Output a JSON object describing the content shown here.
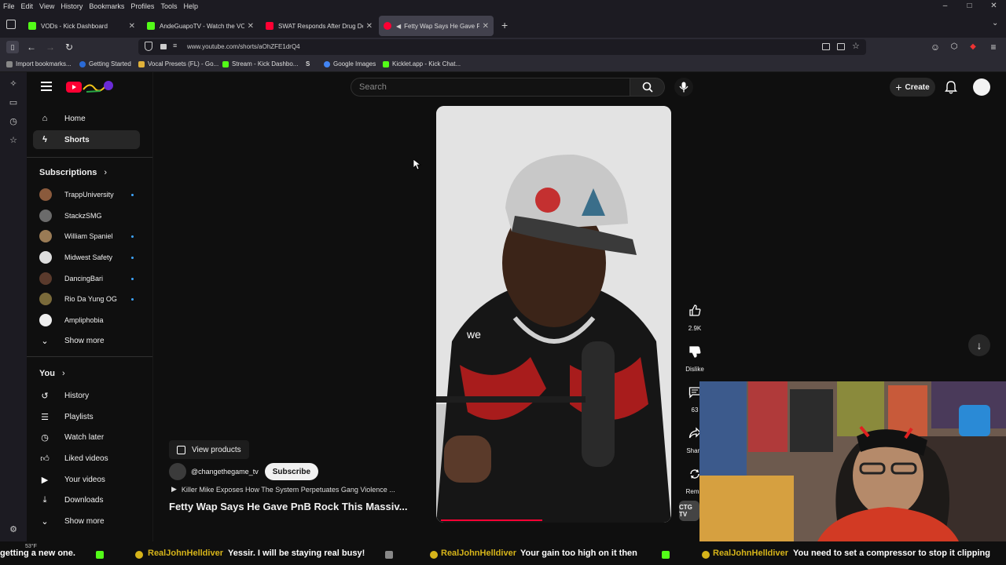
{
  "browser": {
    "menu": [
      "File",
      "Edit",
      "View",
      "History",
      "Bookmarks",
      "Profiles",
      "Tools",
      "Help"
    ],
    "window_controls": [
      "–",
      "□",
      "✕"
    ],
    "tabs": [
      {
        "title": "VODs - Kick Dashboard",
        "fav_color": "#53fc18"
      },
      {
        "title": "AndeGuapoTV - Watch the VO",
        "fav_color": "#53fc18"
      },
      {
        "title": "SWAT Responds After Drug De",
        "fav_color": "#ff0033"
      },
      {
        "title": "Fetty Wap Says He Gave Pn",
        "fav_color": "#ff0033"
      }
    ],
    "new_tab": "+",
    "url": "www.youtube.com/shorts/aOhZFE1drQ4",
    "bookmarks": [
      {
        "label": "Import bookmarks...",
        "color": "#888888"
      },
      {
        "label": "Getting Started",
        "color": "#2a6ad6"
      },
      {
        "label": "Vocal Presets (FL) - Go...",
        "color": "#e0b13a"
      },
      {
        "label": "Stream - Kick Dashbo...",
        "color": "#53fc18"
      },
      {
        "label": "Google Images",
        "color": "#4285f4"
      },
      {
        "label": "Kicklet.app - Kick Chat...",
        "color": "#53fc18"
      }
    ]
  },
  "youtube": {
    "search_placeholder": "Search",
    "create_label": "Create",
    "guide": {
      "home": "Home",
      "shorts": "Shorts",
      "subscriptions_title": "Subscriptions",
      "subscriptions": [
        {
          "name": "TrappUniversity",
          "color": "#8a5a3c",
          "new": true
        },
        {
          "name": "StackzSMG",
          "color": "#6b6b6b",
          "new": false
        },
        {
          "name": "William Spaniel",
          "color": "#9a7b55",
          "new": true
        },
        {
          "name": "Midwest Safety",
          "color": "#dddddd",
          "new": true
        },
        {
          "name": "DancingBari",
          "color": "#5a3a2c",
          "new": true
        },
        {
          "name": "Rio Da Yung OG",
          "color": "#7a6a3a",
          "new": true
        },
        {
          "name": "Ampliphobia",
          "color": "#eeeeee",
          "new": false
        }
      ],
      "show_more": "Show more",
      "you_title": "You",
      "you_items": [
        "History",
        "Playlists",
        "Watch later",
        "Liked videos",
        "Your videos",
        "Downloads"
      ],
      "show_more_2": "Show more"
    },
    "short": {
      "caption": "we",
      "progress_fraction": 0.43,
      "likes": "2.9K",
      "dislike": "Dislike",
      "comments": "63",
      "share": "Share",
      "remix": "Remix",
      "channel_thumb_text": "CTG TV",
      "view_products": "View products",
      "channel": "@changethegame_tv",
      "subscribe": "Subscribe",
      "suggested": "Killer Mike Exposes How The System Perpetuates Gang Violence ...",
      "title": "Fetty Wap Says He Gave PnB Rock This Massiv..."
    }
  },
  "ticker": {
    "msg1": "getting a new one.",
    "user1": "RealJohnHelldiver",
    "msg2": "Yessir. I will be staying real busy!",
    "user2": "RealJohnHelldiver",
    "msg3": "Your gain too high on it then",
    "user3": "RealJohnHelldiver",
    "msg4": "You need to set a compressor to stop it clipping",
    "weather": "53°F"
  }
}
